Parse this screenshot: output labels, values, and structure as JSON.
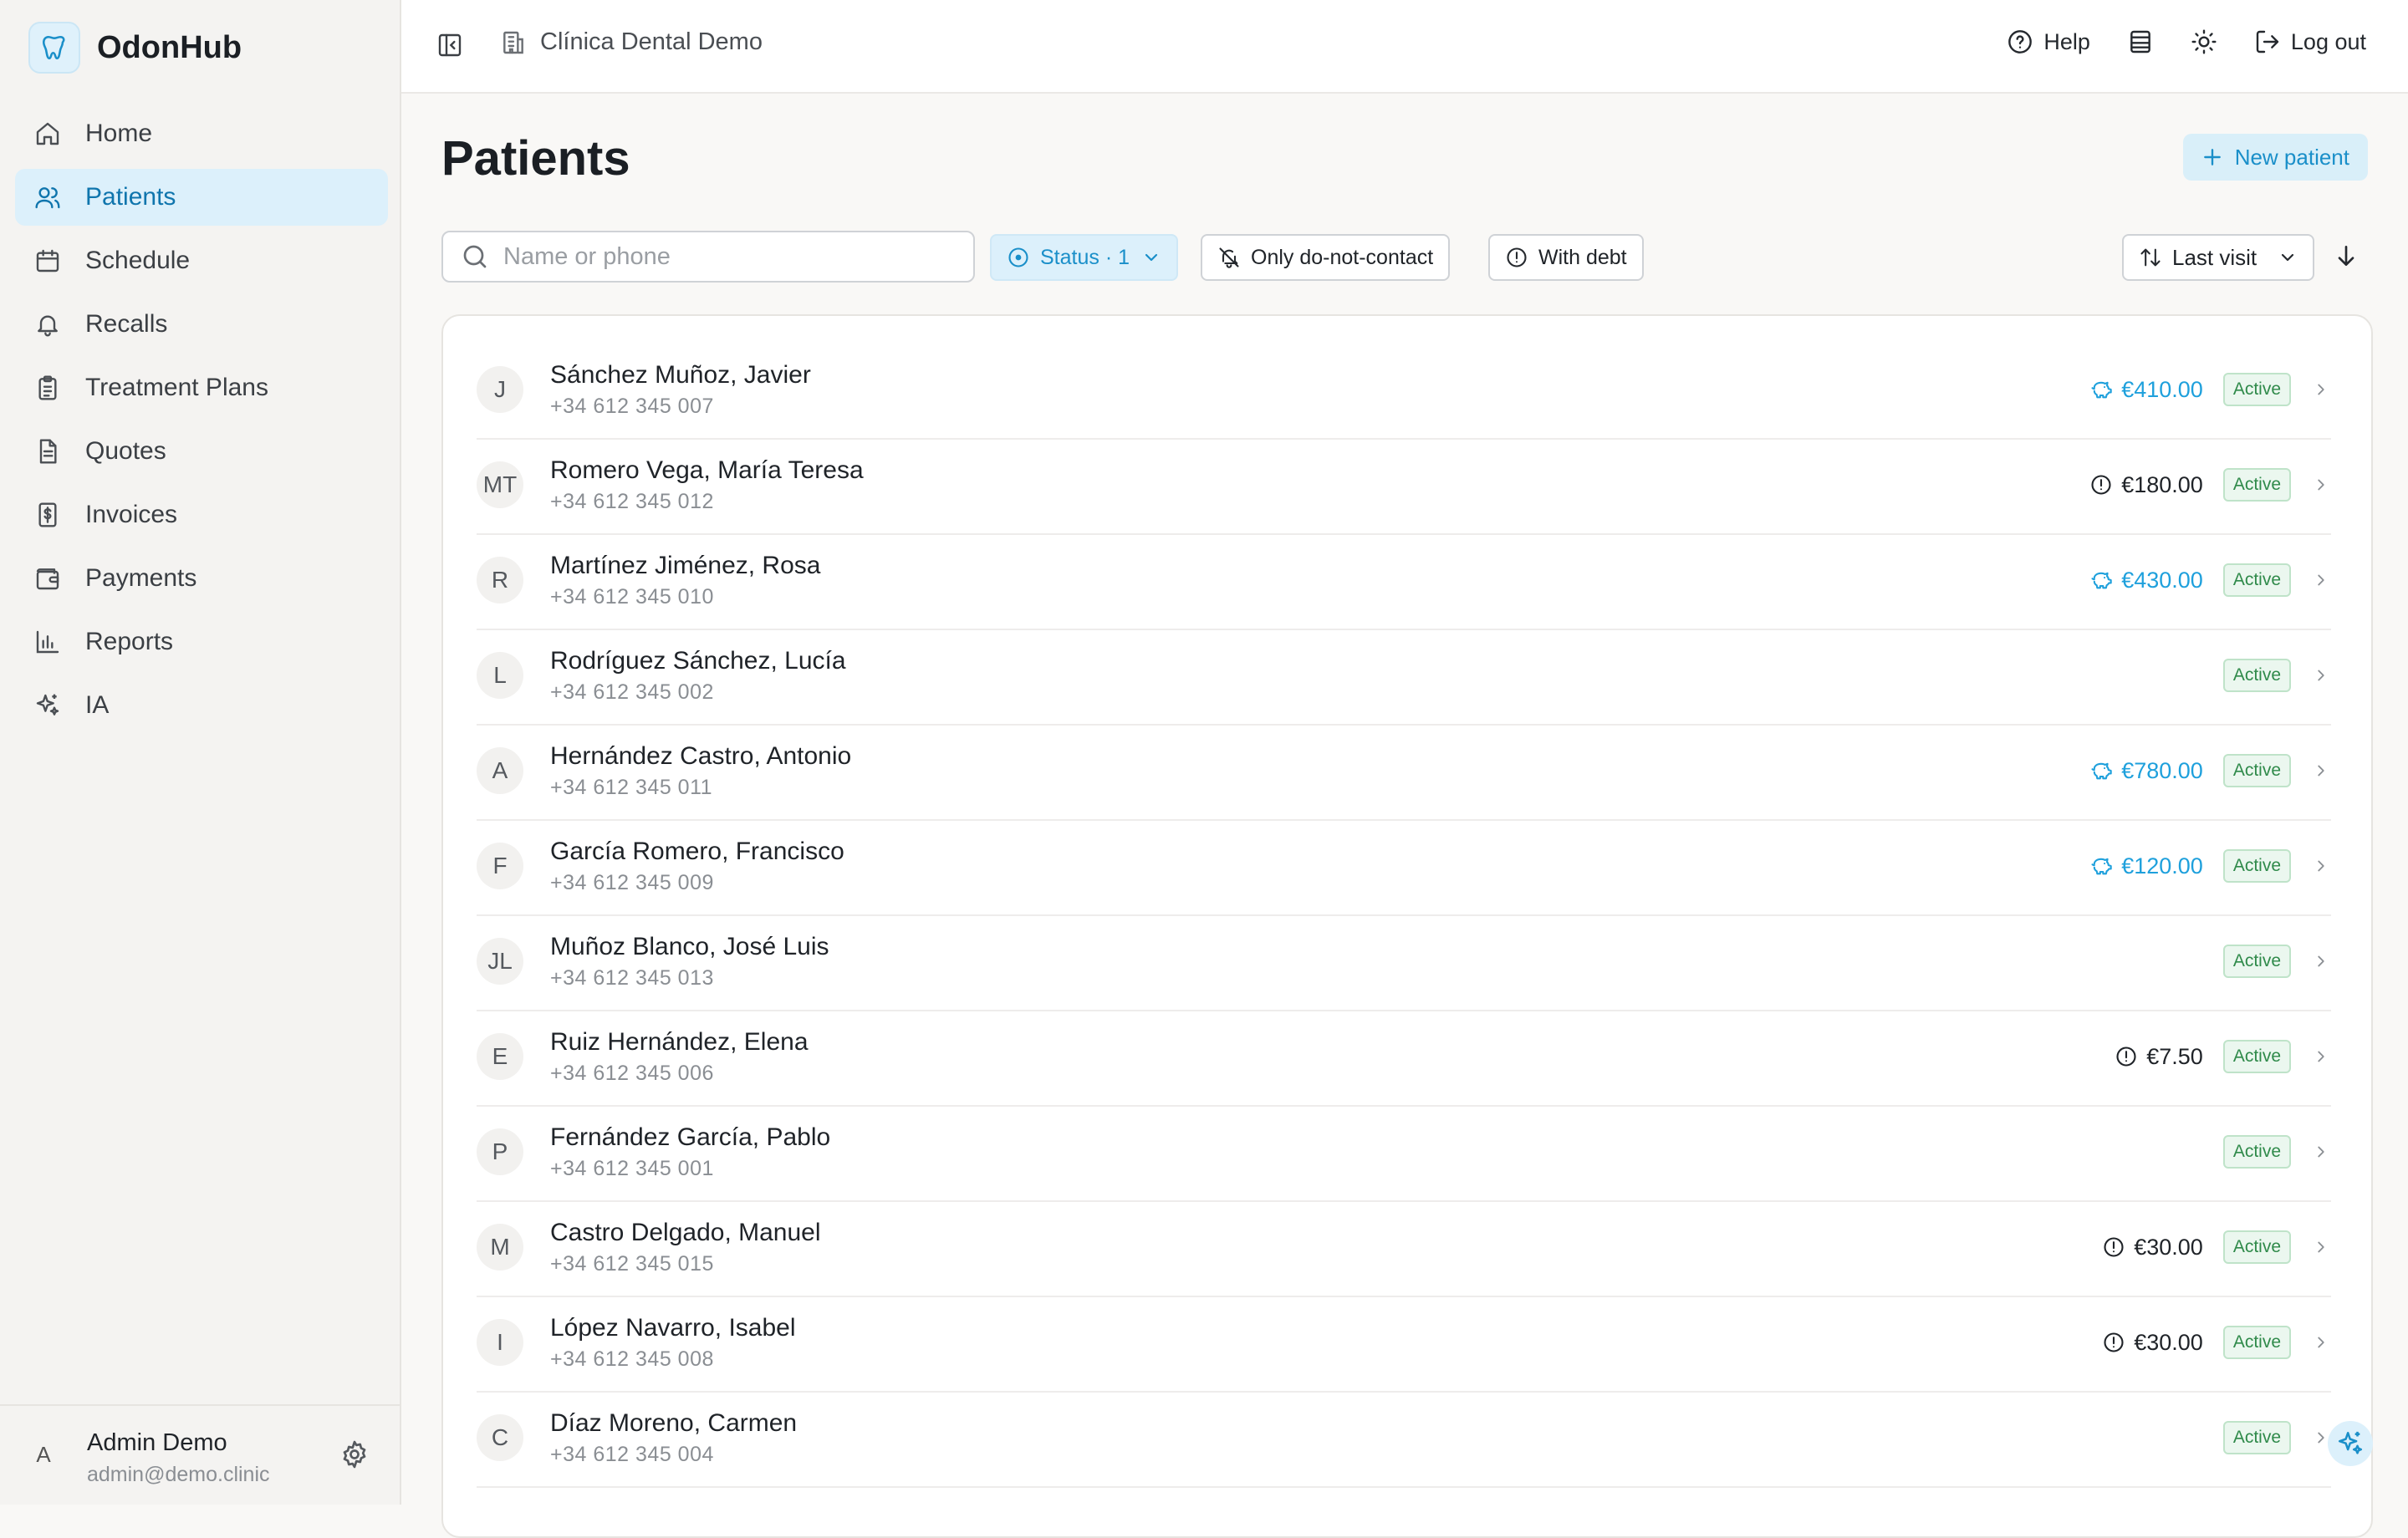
{
  "brand": {
    "name": "OdonHub",
    "icon": "tooth-icon"
  },
  "sidebar": {
    "items": [
      {
        "label": "Home",
        "icon": "home-icon"
      },
      {
        "label": "Patients",
        "icon": "users-icon",
        "active": true
      },
      {
        "label": "Schedule",
        "icon": "calendar-icon"
      },
      {
        "label": "Recalls",
        "icon": "bell-icon"
      },
      {
        "label": "Treatment Plans",
        "icon": "clipboard-icon"
      },
      {
        "label": "Quotes",
        "icon": "document-icon"
      },
      {
        "label": "Invoices",
        "icon": "receipt-icon"
      },
      {
        "label": "Payments",
        "icon": "wallet-icon"
      },
      {
        "label": "Reports",
        "icon": "bar-chart-icon"
      },
      {
        "label": "IA",
        "icon": "sparkles-icon"
      }
    ]
  },
  "user": {
    "initial": "A",
    "name": "Admin Demo",
    "email": "admin@demo.clinic"
  },
  "topbar": {
    "clinic": "Clínica Dental Demo",
    "help": "Help",
    "logout": "Log out"
  },
  "page": {
    "title": "Patients",
    "new_button": "New patient"
  },
  "filters": {
    "search_placeholder": "Name or phone",
    "status": "Status · 1",
    "dnc": "Only do-not-contact",
    "debt": "With debt",
    "sort": "Last visit"
  },
  "patients": [
    {
      "initials": "J",
      "name": "Sánchez Muñoz, Javier",
      "phone": "+34 612 345 007",
      "amount": "€410.00",
      "amount_type": "credit",
      "status": "Active"
    },
    {
      "initials": "MT",
      "name": "Romero Vega, María Teresa",
      "phone": "+34 612 345 012",
      "amount": "€180.00",
      "amount_type": "debt",
      "status": "Active"
    },
    {
      "initials": "R",
      "name": "Martínez Jiménez, Rosa",
      "phone": "+34 612 345 010",
      "amount": "€430.00",
      "amount_type": "credit",
      "status": "Active"
    },
    {
      "initials": "L",
      "name": "Rodríguez Sánchez, Lucía",
      "phone": "+34 612 345 002",
      "amount": "",
      "amount_type": "none",
      "status": "Active"
    },
    {
      "initials": "A",
      "name": "Hernández Castro, Antonio",
      "phone": "+34 612 345 011",
      "amount": "€780.00",
      "amount_type": "credit",
      "status": "Active"
    },
    {
      "initials": "F",
      "name": "García Romero, Francisco",
      "phone": "+34 612 345 009",
      "amount": "€120.00",
      "amount_type": "credit",
      "status": "Active"
    },
    {
      "initials": "JL",
      "name": "Muñoz Blanco, José Luis",
      "phone": "+34 612 345 013",
      "amount": "",
      "amount_type": "none",
      "status": "Active"
    },
    {
      "initials": "E",
      "name": "Ruiz Hernández, Elena",
      "phone": "+34 612 345 006",
      "amount": "€7.50",
      "amount_type": "debt",
      "status": "Active"
    },
    {
      "initials": "P",
      "name": "Fernández García, Pablo",
      "phone": "+34 612 345 001",
      "amount": "",
      "amount_type": "none",
      "status": "Active"
    },
    {
      "initials": "M",
      "name": "Castro Delgado, Manuel",
      "phone": "+34 612 345 015",
      "amount": "€30.00",
      "amount_type": "debt",
      "status": "Active"
    },
    {
      "initials": "I",
      "name": "López Navarro, Isabel",
      "phone": "+34 612 345 008",
      "amount": "€30.00",
      "amount_type": "debt",
      "status": "Active"
    },
    {
      "initials": "C",
      "name": "Díaz Moreno, Carmen",
      "phone": "+34 612 345 004",
      "amount": "",
      "amount_type": "none",
      "status": "Active"
    }
  ],
  "colors": {
    "accent": "#1a8fc9",
    "active_nav_bg": "#dcf0fb",
    "badge_green": "#2f8a4a",
    "credit": "#1ea0dc"
  }
}
